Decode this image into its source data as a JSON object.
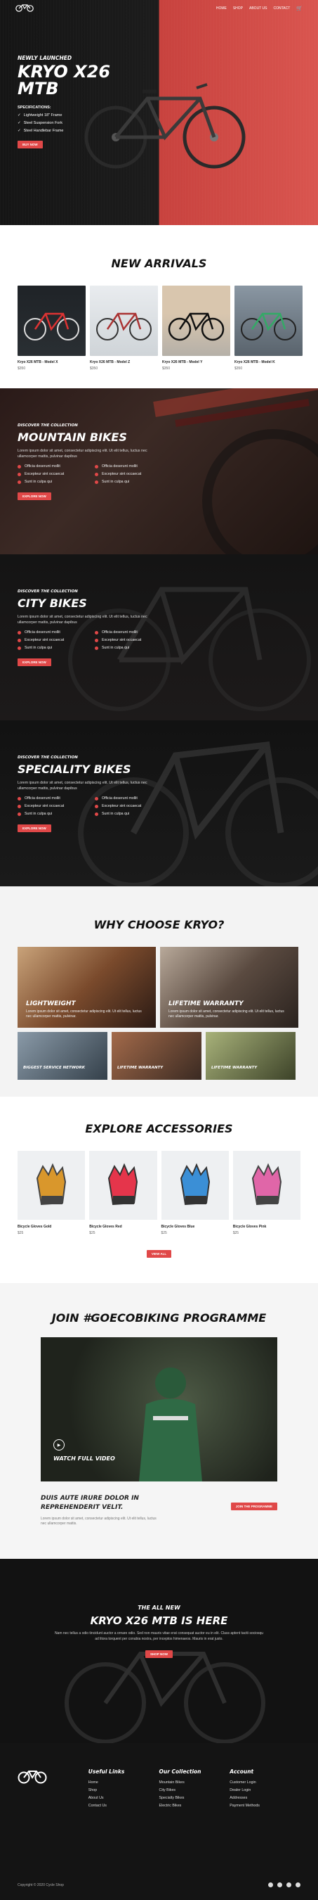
{
  "nav": {
    "items": [
      "HOME",
      "SHOP",
      "ABOUT US",
      "CONTACT"
    ]
  },
  "hero": {
    "kicker": "NEWLY LAUNCHED",
    "title": "KRYO X26 MTB",
    "specs_title": "SPECIFICATIONS:",
    "specs": [
      "Lightweight 18\" Frame",
      "Steel Suspension Fork",
      "Steel Handlebar Frame"
    ],
    "button": "BUY NOW"
  },
  "arrivals": {
    "title": "NEW ARRIVALS",
    "items": [
      {
        "name": "Kryo X26 MTB - Model X",
        "price": "$350"
      },
      {
        "name": "Kryo X26 MTB - Model Z",
        "price": "$350"
      },
      {
        "name": "Kryo X26 MTB - Model Y",
        "price": "$350"
      },
      {
        "name": "Kryo X26 MTB - Model K",
        "price": "$350"
      }
    ]
  },
  "collections": [
    {
      "kicker": "DISCOVER THE COLLECTION",
      "title": "MOUNTAIN BIKES",
      "text": "Lorem ipsum dolor sit amet, consectetur adipiscing elit. Ut elit tellus, luctus nec ullamcorper mattis, pulvinar dapibus",
      "features": [
        "Officia deserunt mollit",
        "Officia deserunt mollit",
        "Excepteur sint occaecat",
        "Excepteur sint occaecat",
        "Sunt in culpa qui",
        "Sunt in culpa qui"
      ],
      "button": "EXPLORE NOW"
    },
    {
      "kicker": "DISCOVER THE COLLECTION",
      "title": "CITY BIKES",
      "text": "Lorem ipsum dolor sit amet, consectetur adipiscing elit. Ut elit tellus, luctus nec ullamcorper mattis, pulvinar dapibus",
      "features": [
        "Officia deserunt mollit",
        "Officia deserunt mollit",
        "Excepteur sint occaecat",
        "Excepteur sint occaecat",
        "Sunt in culpa qui",
        "Sunt in culpa qui"
      ],
      "button": "EXPLORE NOW"
    },
    {
      "kicker": "DISCOVER THE COLLECTION",
      "title": "SPECIALITY BIKES",
      "text": "Lorem ipsum dolor sit amet, consectetur adipiscing elit. Ut elit tellus, luctus nec ullamcorper mattis, pulvinar dapibus",
      "features": [
        "Officia deserunt mollit",
        "Officia deserunt mollit",
        "Excepteur sint occaecat",
        "Excepteur sint occaecat",
        "Sunt in culpa qui",
        "Sunt in culpa qui"
      ],
      "button": "EXPLORE NOW"
    }
  ],
  "why": {
    "title": "WHY CHOOSE KRYO?",
    "big": [
      {
        "title": "LIGHTWEIGHT",
        "text": "Lorem ipsum dolor sit amet, consectetur adipiscing elit. Ut elit tellus, luctus nec ullamcorper mattis, pulvinar."
      },
      {
        "title": "LIFETIME WARRANTY",
        "text": "Lorem ipsum dolor sit amet, consectetur adipiscing elit. Ut elit tellus, luctus nec ullamcorper mattis, pulvinar."
      }
    ],
    "small": [
      "BIGGEST SERVICE NETWORK",
      "LIFETIME WARRANTY",
      "LIFETIME WARRANTY"
    ]
  },
  "accessories": {
    "title": "EXPLORE ACCESSORIES",
    "items": [
      {
        "name": "Bicycle Gloves Gold",
        "price": "$25",
        "color": "#d9972c"
      },
      {
        "name": "Bicycle Gloves Red",
        "price": "$25",
        "color": "#e5354b"
      },
      {
        "name": "Bicycle Gloves Blue",
        "price": "$25",
        "color": "#3b8fd6"
      },
      {
        "name": "Bicycle Gloves Pink",
        "price": "$25",
        "color": "#e066a8"
      }
    ],
    "button": "VIEW ALL"
  },
  "programme": {
    "title": "JOIN #GOECOBIKING PROGRAMME",
    "video_label": "WATCH FULL VIDEO",
    "heading": "DUIS AUTE IRURE DOLOR IN REPREHENDERIT VELIT.",
    "text": "Lorem ipsum dolor sit amet, consectetur adipiscing elit. Ut elit tellus, luctus nec ullamcorper mattis.",
    "button": "JOIN THE PROGRAMME"
  },
  "cta": {
    "kicker": "THE ALL NEW",
    "title": "KRYO X26 MTB IS HERE",
    "text": "Nam nec tellus a odio tincidunt auctor a ornare odio. Sed non mauris vitae erat consequat auctor eu in elit. Class aptent taciti sociosqu ad litora torquent per conubia nostra, per inceptos himenaeos. Mauris in erat justo.",
    "button": "SHOP NOW"
  },
  "footer": {
    "cols": [
      {
        "title": "Useful Links",
        "items": [
          "Home",
          "Shop",
          "About Us",
          "Contact Us"
        ]
      },
      {
        "title": "Our Collection",
        "items": [
          "Mountain Bikes",
          "City Bikes",
          "Specialty Bikes",
          "Electric Bikes"
        ]
      },
      {
        "title": "Account",
        "items": [
          "Customer Login",
          "Dealer Login",
          "Addresses",
          "Payment Methods"
        ]
      }
    ],
    "copyright": "Copyright © 2020 Cycle Shop"
  }
}
